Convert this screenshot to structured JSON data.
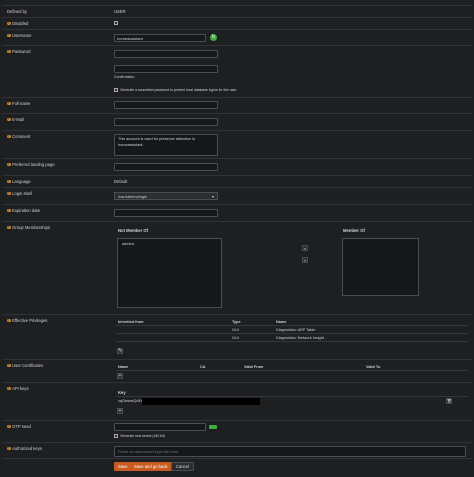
{
  "fields": {
    "defined_by": {
      "label": "Defined by",
      "value": "USER"
    },
    "disabled": {
      "label": "Disabled"
    },
    "username": {
      "label": "Username",
      "value": "homeassistant"
    },
    "password": {
      "label": "Password",
      "confirmation": "Confirmation",
      "scramble_text": "Generate a scrambled password to prevent local database logins for this user."
    },
    "full_name": {
      "label": "Full name"
    },
    "email": {
      "label": "E-Mail"
    },
    "comment": {
      "label": "Comment",
      "value": "This account is used for presence detection in homeassistant."
    },
    "landing_page": {
      "label": "Preferred landing page"
    },
    "language": {
      "label": "Language",
      "value": "Default"
    },
    "login_shell": {
      "label": "Login shell",
      "value": "/usr/sbin/nologin"
    },
    "expiration": {
      "label": "Expiration date"
    },
    "groups": {
      "label": "Group Memberships",
      "not_member_header": "Not Member Of",
      "member_header": "Member Of",
      "not_member_items": [
        "admins"
      ],
      "add_label": "»",
      "remove_label": "«"
    },
    "privileges": {
      "label": "Effective Privileges",
      "headers": [
        "Inherited from",
        "Type",
        "Name"
      ],
      "rows": [
        [
          "",
          "GUI",
          "Diagnostics: ARP Table"
        ],
        [
          "",
          "GUI",
          "Diagnostics: Network Insight"
        ]
      ],
      "edit_label": "✎"
    },
    "certificates": {
      "label": "User Certificates",
      "headers": [
        "Name",
        "CA",
        "Valid From",
        "Valid To"
      ],
      "add_label": "+"
    },
    "api_keys": {
      "label": "API keys",
      "header": "Key",
      "key_prefix": "cqOwwwQx5Xj",
      "add_label": "+",
      "delete_label": "🗑"
    },
    "otp_seed": {
      "label": "OTP seed",
      "generate_text": "Generate new secret (160 bit)"
    },
    "authorized_keys": {
      "label": "Authorized keys",
      "placeholder": "Paste an authorized keys file here."
    }
  },
  "actions": {
    "save": "Save",
    "save_back": "Save and go back",
    "cancel": "Cancel"
  },
  "colors": {
    "accent": "#c95b22",
    "info_icon": "#d3852b",
    "background": "#1e1f21"
  }
}
